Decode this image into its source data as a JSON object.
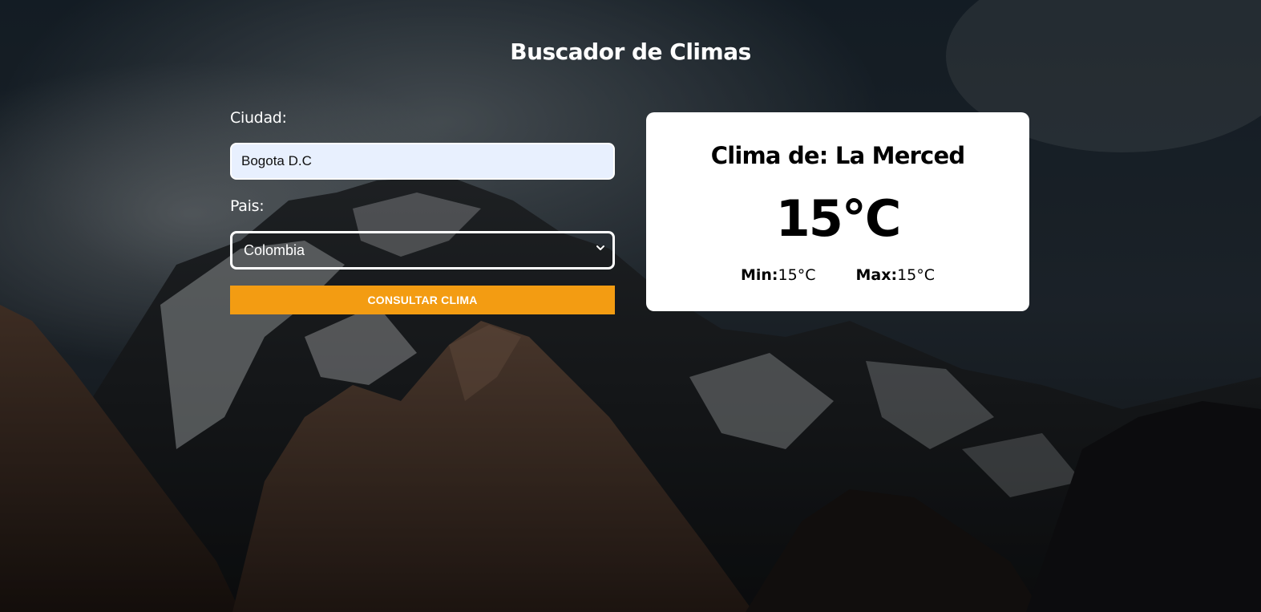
{
  "header": {
    "title": "Buscador de Climas"
  },
  "form": {
    "city_label": "Ciudad:",
    "city_value": "Bogota D.C",
    "country_label": "Pais:",
    "country_selected": "Colombia",
    "submit_label": "CONSULTAR CLIMA"
  },
  "result": {
    "title": "Clima de: La Merced",
    "temperature": "15°C",
    "min_label": "Min:",
    "min_value": "15°C",
    "max_label": "Max:",
    "max_value": "15°C"
  },
  "colors": {
    "accent": "#f39c12",
    "input_bg": "#e8f0fe",
    "card_bg": "#ffffff"
  },
  "icons": {
    "select_arrow": "chevron-down-icon"
  }
}
